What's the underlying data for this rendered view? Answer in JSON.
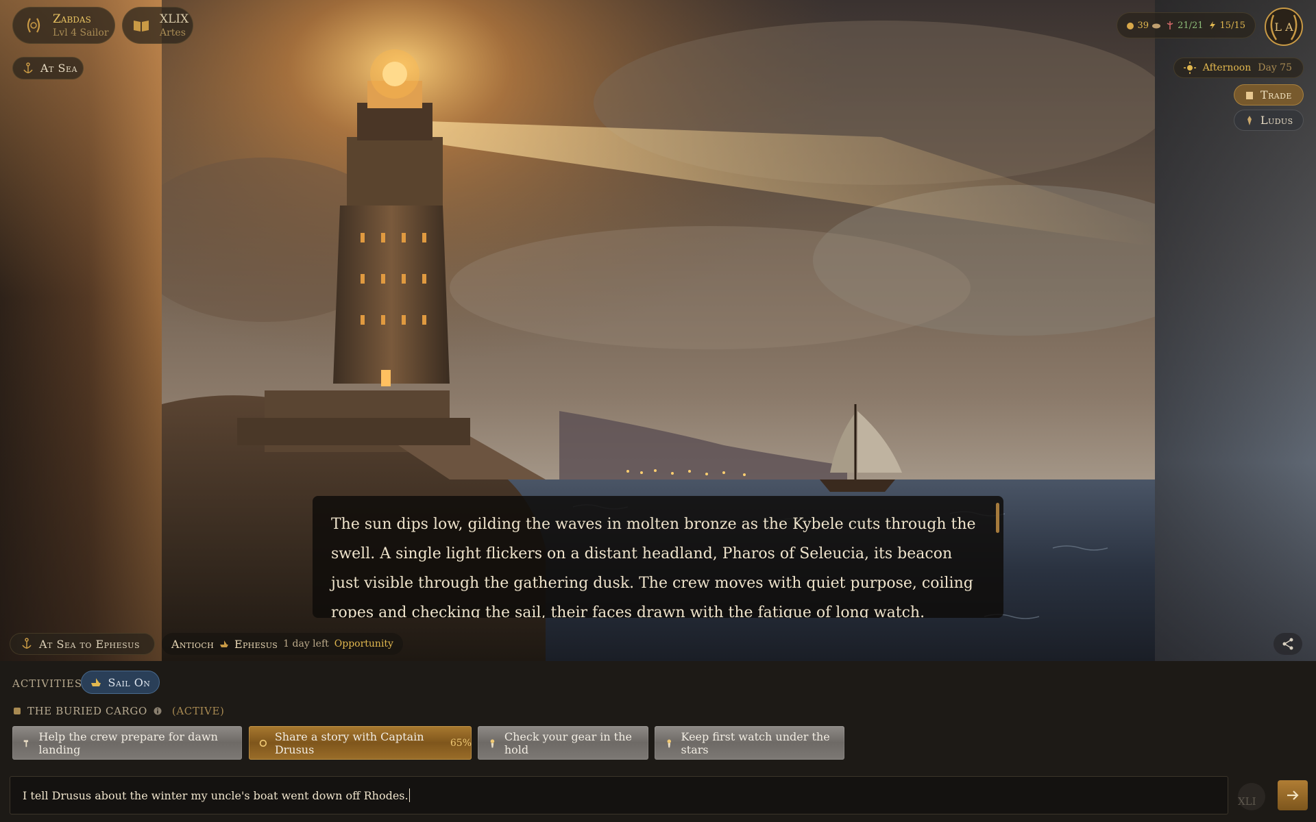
{
  "player": {
    "name": "Zabdas",
    "subtitle": "Lvl 4 Sailor"
  },
  "artes": {
    "value": "XLIX",
    "label": "Artes"
  },
  "location": {
    "label": "At Sea"
  },
  "stats": {
    "coins": "39",
    "health": "21/21",
    "energy": "15/15"
  },
  "emblem": {
    "initials": "L A"
  },
  "time": {
    "period": "Afternoon",
    "day": "Day 75"
  },
  "side_buttons": {
    "trade": "Trade",
    "ludus": "Ludus"
  },
  "narrative": {
    "text": "The sun dips low, gilding the waves in molten bronze as the Kybele cuts through the swell. A single light flickers on a distant headland, Pharos of Seleucia, its beacon just visible through the gathering dusk. The crew moves with quiet purpose, coiling ropes and checking the sail, their faces drawn with the fatigue of long watch. Captain Drusus stands at the"
  },
  "route": {
    "status": "At Sea to Ephesus",
    "from": "Antioch",
    "to": "Ephesus",
    "remaining": "1 day left",
    "tag": "Opportunity"
  },
  "activities": {
    "label": "ACTIVITIES:",
    "sail_label": "Sail On"
  },
  "quest": {
    "title": "THE BURIED CARGO",
    "status": "(ACTIVE)"
  },
  "choices": [
    {
      "label": "Help the crew prepare for dawn landing",
      "icon": "hammer-icon"
    },
    {
      "label": "Share a story with Captain Drusus",
      "pct": "65%",
      "icon": "laurel-icon"
    },
    {
      "label": "Check your gear in the hold",
      "icon": "torch-icon"
    },
    {
      "label": "Keep first watch under the stars",
      "icon": "torch-icon"
    }
  ],
  "input": {
    "value": "I tell Drusus about the winter my uncle's boat went down off Rhodes."
  },
  "page_indicator": "XLI",
  "colors": {
    "gold": "#e2b84f",
    "sail_blue": "#2a3f58",
    "featured_choice": "#a8792f",
    "stone_choice": "#8e8a86"
  }
}
